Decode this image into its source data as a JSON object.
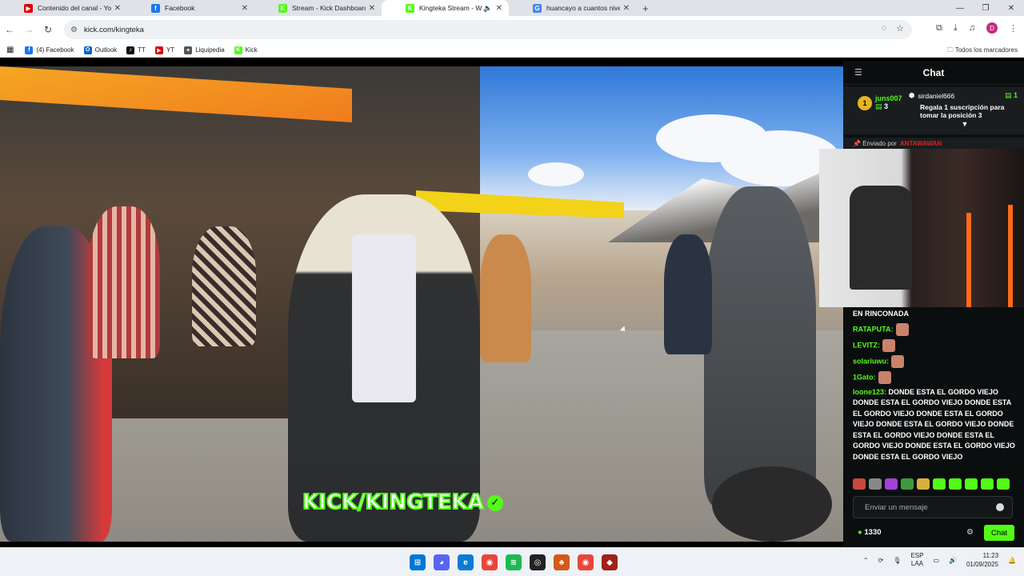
{
  "browser": {
    "tabs": [
      {
        "title": "Contenido del canal - YouTube",
        "icon": "youtube-icon",
        "color": "#e00000",
        "glyph": "▶"
      },
      {
        "title": "Facebook",
        "icon": "facebook-icon",
        "color": "#1877f2",
        "glyph": "f"
      },
      {
        "title": "Stream - Kick Dashboard",
        "icon": "kick-icon",
        "color": "#53fc18",
        "glyph": "K"
      },
      {
        "title": "Kingteka Stream - Watch Li",
        "icon": "kick-icon",
        "color": "#53fc18",
        "glyph": "K",
        "active": true
      },
      {
        "title": "huancayo a cuantos niveles del",
        "icon": "google-icon",
        "color": "#4285f4",
        "glyph": "G"
      }
    ],
    "url": "kick.com/kingteka",
    "profile_initial": "D",
    "bookmarks": [
      {
        "label": "(4) Facebook",
        "icon": "facebook-icon",
        "color": "#1877f2",
        "glyph": "f"
      },
      {
        "label": "Outlook",
        "icon": "outlook-icon",
        "color": "#0a64c8",
        "glyph": "O"
      },
      {
        "label": "TT",
        "icon": "tiktok-icon",
        "color": "#111111",
        "glyph": "♪"
      },
      {
        "label": "YT",
        "icon": "youtube-icon",
        "color": "#e00000",
        "glyph": "▶"
      },
      {
        "label": "Liquipedia",
        "icon": "liquipedia-icon",
        "color": "#555555",
        "glyph": "✦"
      },
      {
        "label": "Kick",
        "icon": "kick-icon",
        "color": "#53fc18",
        "glyph": "K"
      }
    ],
    "all_bookmarks": "Todos los marcadores"
  },
  "stream": {
    "brand": "KICK/KINGTEKA"
  },
  "chat": {
    "header": "Chat",
    "pinned_user": "juns007",
    "pinned_user_count": "3",
    "pinned_rank": "1",
    "sub_user": "sirdaniel666",
    "sub_count": "1",
    "sub_message": "Regala 1 suscripción para tomar la posición 3",
    "sent_by_label": "Enviado por",
    "sent_by_user": "ANTAWAWAN",
    "context_line": "EN RINCONADA",
    "messages": [
      {
        "user": "RATAPUTA:",
        "text": ""
      },
      {
        "user": "LEVITZ:",
        "text": ""
      },
      {
        "user": "solariuwu:",
        "text": ""
      },
      {
        "user": "1Gato:",
        "text": ""
      },
      {
        "user": "loone123:",
        "text": " DONDE ESTA EL GORDO VIEJO DONDE ESTA EL GORDO VIEJO DONDE ESTA EL GORDO VIEJO DONDE ESTA EL GORDO VIEJO DONDE ESTA EL GORDO VIEJO DONDE ESTA EL GORDO VIEJO DONDE ESTA EL GORDO VIEJO DONDE ESTA EL GORDO VIEJO DONDE ESTA EL GORDO VIEJO"
      }
    ],
    "input_placeholder": "Enviar un mensaje",
    "points": "1330",
    "send_label": "Chat"
  },
  "taskbar": {
    "lang": "ESP",
    "lang_sub": "LAA",
    "time": "11:23",
    "date": "01/09/2025"
  }
}
